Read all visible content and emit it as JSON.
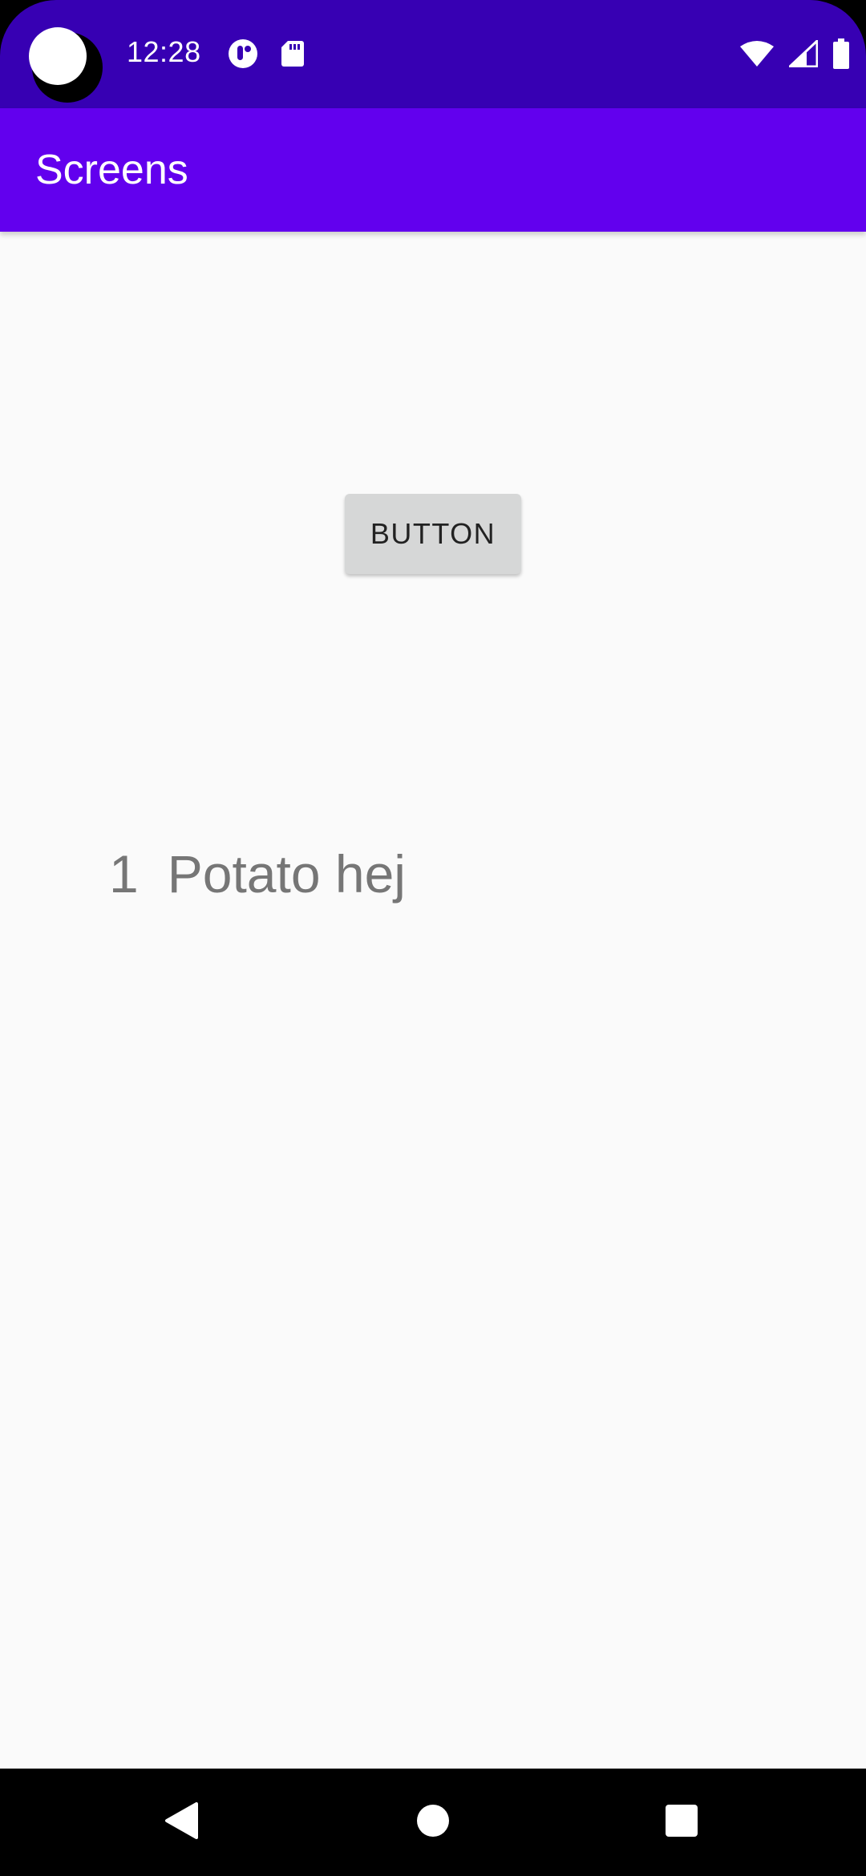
{
  "status_bar": {
    "time": "12:28",
    "icons_left": [
      "notification-app-icon",
      "sd-card-icon"
    ],
    "icons_right": [
      "wifi-icon",
      "signal-icon",
      "battery-icon"
    ]
  },
  "app_bar": {
    "title": "Screens"
  },
  "content": {
    "button_label": "BUTTON",
    "list_item": {
      "number": "1",
      "text": "Potato hej"
    }
  },
  "nav_bar": {
    "icons": [
      "back-icon",
      "home-icon",
      "recents-icon"
    ]
  },
  "colors": {
    "status_bar": "#3700b3",
    "app_bar": "#6200ee",
    "background": "#fafafa",
    "button": "#d6d7d7",
    "list_text": "#767676"
  }
}
